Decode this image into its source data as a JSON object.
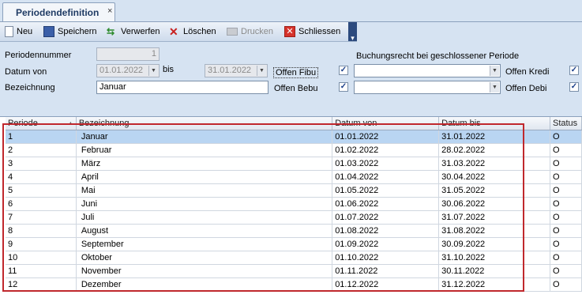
{
  "tab": {
    "title": "Periodendefinition",
    "close": "×"
  },
  "toolbar": {
    "new_label": "Neu",
    "save_label": "Speichern",
    "discard_label": "Verwerfen",
    "delete_label": "Löschen",
    "print_label": "Drucken",
    "close_label": "Schliessen"
  },
  "form": {
    "period_number_label": "Periodennummer",
    "period_number_value": "1",
    "date_from_label": "Datum von",
    "date_from_value": "01.01.2022",
    "bis_label": "bis",
    "date_to_value": "31.01.2022",
    "description_label": "Bezeichnung",
    "description_value": "Januar",
    "offen_fibu_label": "Offen Fibu",
    "offen_bebu_label": "Offen Bebu",
    "booking_rights_label": "Buchungsrecht bei geschlossener Periode",
    "offen_kredi_label": "Offen Kredi",
    "offen_debi_label": "Offen Debi",
    "check_mark": "✓"
  },
  "grid": {
    "columns": [
      "Periode",
      "Bezeichnung",
      "Datum von",
      "Datum bis",
      "Status"
    ],
    "rows": [
      [
        "1",
        "Januar",
        "01.01.2022",
        "31.01.2022",
        "O"
      ],
      [
        "2",
        "Februar",
        "01.02.2022",
        "28.02.2022",
        "O"
      ],
      [
        "3",
        "März",
        "01.03.2022",
        "31.03.2022",
        "O"
      ],
      [
        "4",
        "April",
        "01.04.2022",
        "30.04.2022",
        "O"
      ],
      [
        "5",
        "Mai",
        "01.05.2022",
        "31.05.2022",
        "O"
      ],
      [
        "6",
        "Juni",
        "01.06.2022",
        "30.06.2022",
        "O"
      ],
      [
        "7",
        "Juli",
        "01.07.2022",
        "31.07.2022",
        "O"
      ],
      [
        "8",
        "August",
        "01.08.2022",
        "31.08.2022",
        "O"
      ],
      [
        "9",
        "September",
        "01.09.2022",
        "30.09.2022",
        "O"
      ],
      [
        "10",
        "Oktober",
        "01.10.2022",
        "31.10.2022",
        "O"
      ],
      [
        "11",
        "November",
        "01.11.2022",
        "30.11.2022",
        "O"
      ],
      [
        "12",
        "Dezember",
        "01.12.2022",
        "31.12.2022",
        "O"
      ]
    ]
  }
}
